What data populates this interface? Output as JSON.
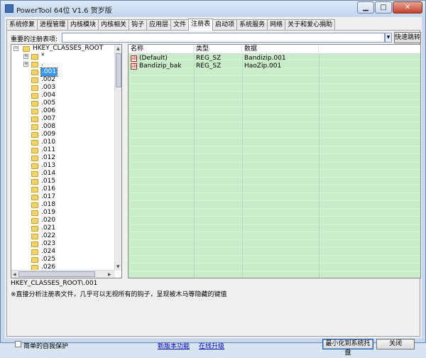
{
  "window": {
    "title": "PowerTool 64位 V1.6 贺岁版"
  },
  "window_buttons": {
    "minimize": "▁",
    "maximize": "□",
    "close": "✕"
  },
  "tabs": [
    {
      "label": "系统修复"
    },
    {
      "label": "进程管理"
    },
    {
      "label": "内核模块"
    },
    {
      "label": "内核相关"
    },
    {
      "label": "钩子"
    },
    {
      "label": "应用层"
    },
    {
      "label": "文件"
    },
    {
      "label": "注册表",
      "active": true
    },
    {
      "label": "启动项"
    },
    {
      "label": "系统服务"
    },
    {
      "label": "网络"
    },
    {
      "label": "关于和爱心捐助"
    }
  ],
  "registry": {
    "label": "重要的注册表项:",
    "input_value": "",
    "jump_label": "快速跳转",
    "root_key": "HKEY_CLASSES_ROOT",
    "sub_star": "*",
    "sub_dot": "."
  },
  "tree_items": [
    ".001",
    ".002",
    ".003",
    ".004",
    ".005",
    ".006",
    ".007",
    ".008",
    ".009",
    ".010",
    ".011",
    ".012",
    ".013",
    ".014",
    ".015",
    ".016",
    ".017",
    ".018",
    ".019",
    ".020",
    ".021",
    ".022",
    ".023",
    ".024",
    ".025",
    ".026"
  ],
  "list": {
    "columns": [
      "名称",
      "类型",
      "数据"
    ],
    "rows": [
      {
        "name": "(Default)",
        "type": "REG_SZ",
        "data": "Bandizip.001"
      },
      {
        "name": "Bandizip_bak",
        "type": "REG_SZ",
        "data": "HaoZip.001"
      }
    ],
    "value_icon": "ab"
  },
  "status": {
    "path": "HKEY_CLASSES_ROOT\\.001",
    "note": "※直接分析注册表文件，几乎可以无视所有的钩子，呈现被木马等隐藏的键值"
  },
  "bottom": {
    "self_protect": "简单的自我保护",
    "new_version": "新版本功能",
    "online_upgrade": "在线升级",
    "minimize_tray": "最小化到系统托盘",
    "close": "关闭"
  },
  "colors": {
    "list_bg": "#c9ecc9",
    "selection": "#3399ff",
    "link": "#0000cc"
  }
}
